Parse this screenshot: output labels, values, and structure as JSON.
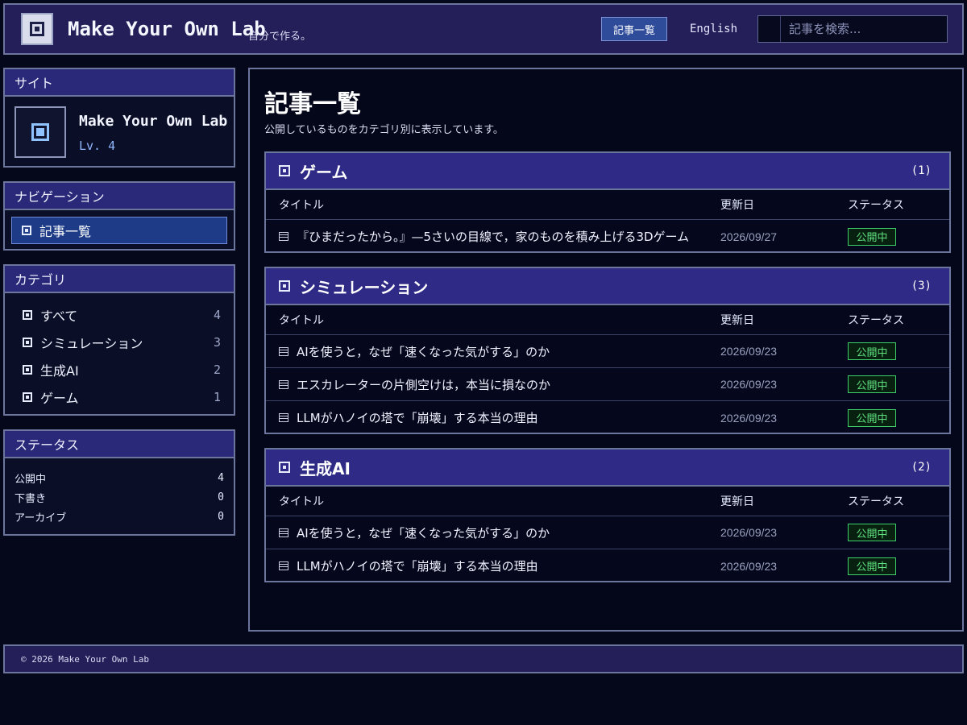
{
  "header": {
    "site_title": "Make Your Own Lab",
    "tagline": "自分で作る。",
    "nav_button": "記事一覧",
    "language_link": "English",
    "search_placeholder": "記事を検索..."
  },
  "sidebar": {
    "site_panel": {
      "heading": "サイト",
      "name": "Make Your Own Lab",
      "level": "Lv. 4"
    },
    "nav_panel": {
      "heading": "ナビゲーション",
      "items": [
        {
          "label": "記事一覧"
        }
      ]
    },
    "category_panel": {
      "heading": "カテゴリ",
      "items": [
        {
          "label": "すべて",
          "count": "4"
        },
        {
          "label": "シミュレーション",
          "count": "3"
        },
        {
          "label": "生成AI",
          "count": "2"
        },
        {
          "label": "ゲーム",
          "count": "1"
        }
      ]
    },
    "status_panel": {
      "heading": "ステータス",
      "items": [
        {
          "label": "公開中",
          "count": "4"
        },
        {
          "label": "下書き",
          "count": "0"
        },
        {
          "label": "アーカイブ",
          "count": "0"
        }
      ]
    }
  },
  "main": {
    "title": "記事一覧",
    "description": "公開しているものをカテゴリ別に表示しています。",
    "columns": {
      "title": "タイトル",
      "date": "更新日",
      "status": "ステータス"
    },
    "sections": [
      {
        "title": "ゲーム",
        "count": "(1)",
        "rows": [
          {
            "title": "『ひまだったから。』—5さいの目線で，家のものを積み上げる3Dゲーム",
            "date": "2026/09/27",
            "status": "公開中"
          }
        ]
      },
      {
        "title": "シミュレーション",
        "count": "(3)",
        "rows": [
          {
            "title": "AIを使うと，なぜ「速くなった気がする」のか",
            "date": "2026/09/23",
            "status": "公開中"
          },
          {
            "title": "エスカレーターの片側空けは，本当に損なのか",
            "date": "2026/09/23",
            "status": "公開中"
          },
          {
            "title": "LLMがハノイの塔で「崩壊」する本当の理由",
            "date": "2026/09/23",
            "status": "公開中"
          }
        ]
      },
      {
        "title": "生成AI",
        "count": "(2)",
        "rows": [
          {
            "title": "AIを使うと，なぜ「速くなった気がする」のか",
            "date": "2026/09/23",
            "status": "公開中"
          },
          {
            "title": "LLMがハノイの塔で「崩壊」する本当の理由",
            "date": "2026/09/23",
            "status": "公開中"
          }
        ]
      }
    ]
  },
  "footer": {
    "copyright": "© 2026 Make Your Own Lab"
  },
  "icons": {
    "logo": "square-logo-icon",
    "section": "square-bullet-icon",
    "article": "document-icon",
    "search": "search-icon"
  },
  "colors": {
    "background": "#05081a",
    "header_bg": "#241e59",
    "panel_head_bg": "#2a2878",
    "section_head_bg": "#2e2a85",
    "border": "#6c759c",
    "active_nav": "#1d3b86",
    "status_green": "#5fe07f",
    "level_blue": "#8fb6ff"
  }
}
